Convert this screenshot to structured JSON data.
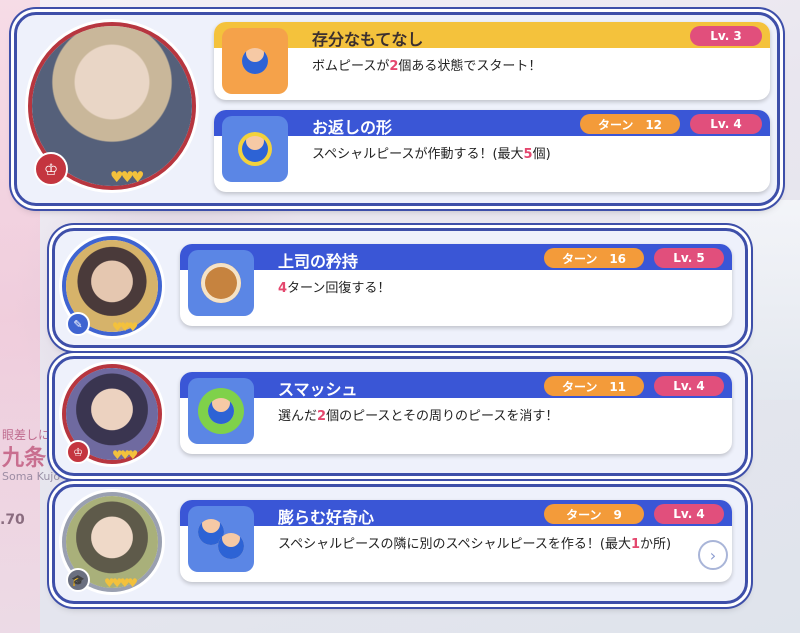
{
  "colors": {
    "accent_blue": "#3e4fa9",
    "lv_pink": "#e14f7c",
    "turn_orange": "#f39b3a",
    "highlight": "#e4476e",
    "gold_band": "#f4c23c"
  },
  "background": {
    "name_text": "九条",
    "romaji": "Soma Kujo",
    "small_text": "眼差しに",
    "number": ".70"
  },
  "cards": [
    {
      "rank_icon": "crown-icon",
      "hearts": "♥♥♥",
      "skills": [
        {
          "title": "存分なもてなし",
          "lv": "Lv. 3",
          "turn": "",
          "desc_parts": [
            "ボムピースが",
            "2",
            "個ある状態でスタート！"
          ],
          "icon": "bomb-piece-icon",
          "band": "gold"
        },
        {
          "title": "お返しの形",
          "lv": "Lv. 4",
          "turn": "ターン　12",
          "desc_parts": [
            "スペシャルピースが作動する！(最大",
            "5",
            "個)"
          ],
          "icon": "special-piece-icon",
          "band": "blue"
        }
      ]
    },
    {
      "rank_icon": "chat-icon",
      "hearts": "♥♥♥",
      "skills": [
        {
          "title": "上司の矜持",
          "lv": "Lv. 5",
          "turn": "ターン　16",
          "desc_parts": [
            "",
            "4",
            "ターン回復する！"
          ],
          "icon": "donut-icon",
          "band": "blue"
        }
      ]
    },
    {
      "rank_icon": "crown-icon",
      "hearts": "♥♥♥",
      "skills": [
        {
          "title": "スマッシュ",
          "lv": "Lv. 4",
          "turn": "ターン　11",
          "desc_parts": [
            "選んだ",
            "2",
            "個のピースとその周りのピースを消す！"
          ],
          "icon": "smash-icon",
          "band": "blue"
        }
      ]
    },
    {
      "rank_icon": "graduation-cap-icon",
      "hearts": "♥♥♥♥",
      "skills": [
        {
          "title": "膨らむ好奇心",
          "lv": "Lv. 4",
          "turn": "ターン　9",
          "desc_parts": [
            "スペシャルピースの隣に別のスペシャルピースを作る！(最大",
            "1",
            "か所)"
          ],
          "icon": "curiosity-icon",
          "band": "blue"
        }
      ]
    }
  ]
}
